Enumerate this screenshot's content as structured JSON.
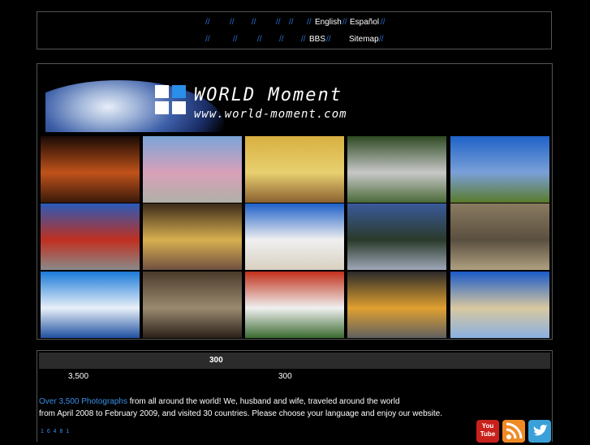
{
  "nav": {
    "row1": {
      "separators": [
        "//",
        "//",
        "//",
        "//",
        "//",
        "//",
        "//"
      ],
      "english": "English",
      "espanol": "Español",
      "sep_mid": "//",
      "sep_end": "//"
    },
    "row2": {
      "separators": [
        "//",
        "//",
        "//",
        "//",
        "//"
      ],
      "bbs": "BBS",
      "sitemap": "Sitemap",
      "sep_mid": "//",
      "sep_end": "//"
    }
  },
  "brand": {
    "title": "WORLD Moment",
    "url": "www.world-moment.com",
    "logo_colors": [
      "#ffffff",
      "#2a8fe8",
      "#ffffff",
      "#ffffff"
    ]
  },
  "photos": [
    {
      "label": "ceremony-fire",
      "colors": [
        "#1a0a05",
        "#c0521a",
        "#3a1a0a"
      ]
    },
    {
      "label": "colonial-church",
      "colors": [
        "#7aa4d8",
        "#d9a0b8",
        "#b0b0a8"
      ]
    },
    {
      "label": "pyramid-group",
      "colors": [
        "#d8b040",
        "#e8d070",
        "#8a6030"
      ]
    },
    {
      "label": "waterfall-rainbow",
      "colors": [
        "#2e4a22",
        "#c8c8c8",
        "#4a6a38"
      ]
    },
    {
      "label": "coast-hill",
      "colors": [
        "#1f62c8",
        "#7aa0d8",
        "#5a7a2a"
      ]
    },
    {
      "label": "red-facade",
      "colors": [
        "#2a5ab8",
        "#c03020",
        "#8a8a8a"
      ]
    },
    {
      "label": "yellow-street",
      "colors": [
        "#3a2a1a",
        "#d8b050",
        "#705040"
      ]
    },
    {
      "label": "beach-clouds",
      "colors": [
        "#1e60c8",
        "#f0f0f0",
        "#d8d0c0"
      ]
    },
    {
      "label": "hilltop-view",
      "colors": [
        "#3a5a9a",
        "#2a3a2a",
        "#a0a8b8"
      ]
    },
    {
      "label": "stone-faces",
      "colors": [
        "#8a7a60",
        "#5a5040",
        "#b0a080"
      ]
    },
    {
      "label": "blue-door",
      "colors": [
        "#1a7ad8",
        "#e8f0f8",
        "#2050a0"
      ]
    },
    {
      "label": "street-kids",
      "colors": [
        "#4a3a2a",
        "#9a8a70",
        "#2a2018"
      ]
    },
    {
      "label": "red-temple",
      "colors": [
        "#c0301a",
        "#f0f0f0",
        "#3a6a30"
      ]
    },
    {
      "label": "children-group",
      "colors": [
        "#2a2a2a",
        "#e0a030",
        "#606060"
      ]
    },
    {
      "label": "desert-flags",
      "colors": [
        "#1a5ac8",
        "#d8c8a0",
        "#8ab0e0"
      ]
    }
  ],
  "info": {
    "header_number": "300",
    "count_left": "3,500",
    "count_right": "300",
    "highlight": "Over 3,500 Photographs",
    "line1_rest": " from all around the world! We, husband and wife, traveled around the world",
    "line2": "from April 2008 to February 2009, and visited 30 countries. Please choose your language and enjoy our website.",
    "counter": "1 6 4 8 1"
  },
  "social": {
    "youtube_label": "You Tube",
    "colors": {
      "youtube": "#c8211b",
      "rss": "#f08a24",
      "twitter": "#3aa0d8"
    }
  },
  "colors": {
    "accent": "#2a6fd4",
    "background": "#000000",
    "border": "#555555"
  }
}
